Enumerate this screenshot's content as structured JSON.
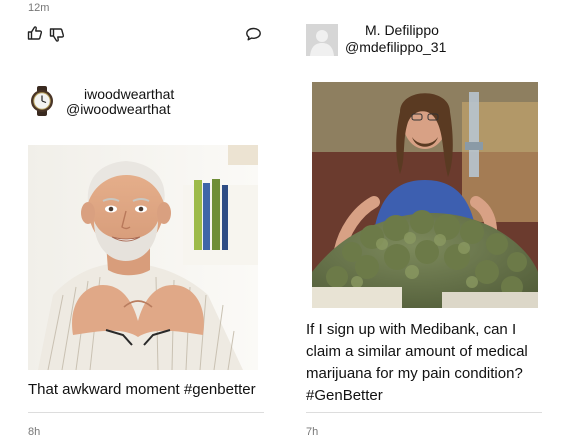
{
  "left_column": {
    "top_timestamp": "12m",
    "actions": {
      "like_icon": "thumbs-up-icon",
      "dislike_icon": "thumbs-down-icon",
      "comment_icon": "comment-icon"
    },
    "post": {
      "display_name": "iwoodwearthat",
      "handle": "@iwoodwearthat",
      "avatar_icon": "watch-icon",
      "caption": "That awkward moment #genbetter",
      "bottom_timestamp": "8h"
    }
  },
  "right_column": {
    "header": {
      "display_name": "M. Defilippo",
      "handle": "@mdefilippo_31",
      "avatar_icon": "default-user-icon"
    },
    "post": {
      "caption_lines": [
        "If I sign up with Medibank, can I",
        "claim a similar amount of medical",
        "marijuana for my pain condition?",
        "#GenBetter"
      ],
      "bottom_timestamp": "7h"
    }
  },
  "colors": {
    "text": "#111111",
    "muted": "#777777",
    "divider": "#dddddd"
  }
}
